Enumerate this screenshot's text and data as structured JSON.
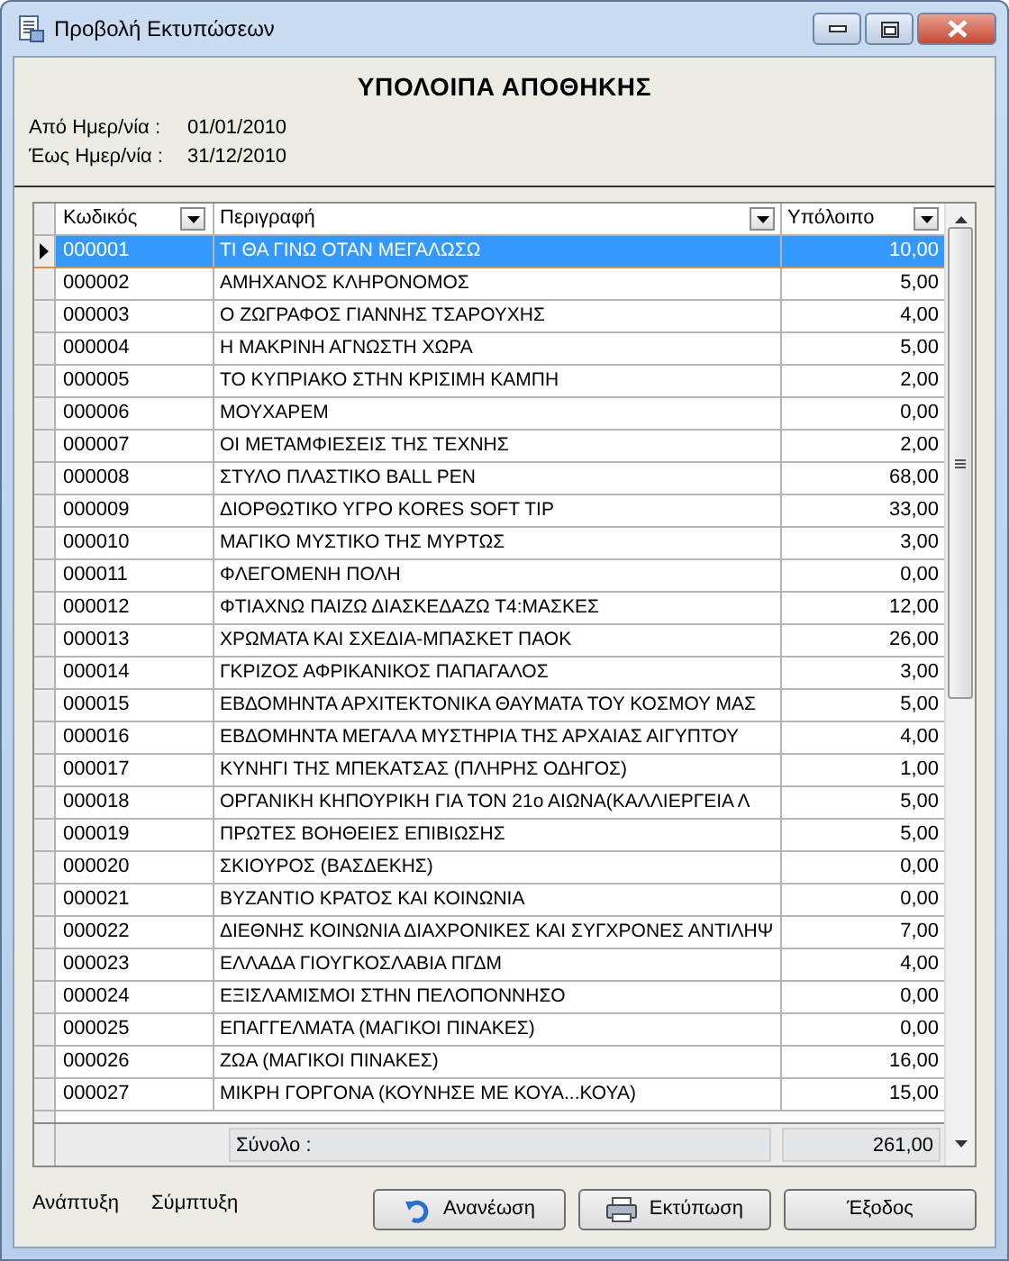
{
  "window": {
    "title": "Προβολή Εκτυπώσεων"
  },
  "report": {
    "title": "ΥΠΟΛΟΙΠΑ ΑΠΟΘΗΚΗΣ",
    "filters": [
      {
        "label": "Από Ημερ/νία :",
        "value": "01/01/2010"
      },
      {
        "label": "Έως Ημερ/νία :",
        "value": "31/12/2010"
      }
    ]
  },
  "table": {
    "columns": [
      "Κωδικός",
      "Περιγραφή",
      "Υπόλοιπο"
    ],
    "rows": [
      {
        "code": "000001",
        "description": "ΤΙ ΘΑ ΓΙΝΩ ΟΤΑΝ ΜΕΓΑΛΩΣΩ",
        "balance": "10,00",
        "selected": true
      },
      {
        "code": "000002",
        "description": "ΑΜΗΧΑΝΟΣ ΚΛΗΡΟΝΟΜΟΣ",
        "balance": "5,00",
        "selected": false
      },
      {
        "code": "000003",
        "description": "Ο ΖΩΓΡΑΦΟΣ ΓΙΑΝΝΗΣ ΤΣΑΡΟΥΧΗΣ",
        "balance": "4,00",
        "selected": false
      },
      {
        "code": "000004",
        "description": "Η ΜΑΚΡΙΝΗ ΑΓΝΩΣΤΗ ΧΩΡΑ",
        "balance": "5,00",
        "selected": false
      },
      {
        "code": "000005",
        "description": "ΤΟ ΚΥΠΡΙΑΚΟ ΣΤΗΝ ΚΡΙΣΙΜΗ ΚΑΜΠΗ",
        "balance": "2,00",
        "selected": false
      },
      {
        "code": "000006",
        "description": "ΜΟΥΧΑΡΕΜ",
        "balance": "0,00",
        "selected": false
      },
      {
        "code": "000007",
        "description": "ΟΙ ΜΕΤΑΜΦΙΕΣΕΙΣ ΤΗΣ ΤΕΧΝΗΣ",
        "balance": "2,00",
        "selected": false
      },
      {
        "code": "000008",
        "description": "ΣΤΥΛΟ ΠΛΑΣΤΙΚΟ BALL PEN",
        "balance": "68,00",
        "selected": false
      },
      {
        "code": "000009",
        "description": "ΔΙΟΡΘΩΤΙΚΟ ΥΓΡΟ KORES SOFT TIP",
        "balance": "33,00",
        "selected": false
      },
      {
        "code": "000010",
        "description": "ΜΑΓΙΚΟ ΜΥΣΤΙΚΟ ΤΗΣ ΜΥΡΤΩΣ",
        "balance": "3,00",
        "selected": false
      },
      {
        "code": "000011",
        "description": "ΦΛΕΓΟΜΕΝΗ ΠΟΛΗ",
        "balance": "0,00",
        "selected": false
      },
      {
        "code": "000012",
        "description": "ΦΤΙΑΧΝΩ ΠΑΙΖΩ ΔΙΑΣΚΕΔΑΖΩ Τ4:ΜΑΣΚΕΣ",
        "balance": "12,00",
        "selected": false
      },
      {
        "code": "000013",
        "description": "ΧΡΩΜΑΤΑ ΚΑΙ ΣΧΕΔΙΑ-ΜΠΑΣΚΕΤ ΠΑΟΚ",
        "balance": "26,00",
        "selected": false
      },
      {
        "code": "000014",
        "description": "ΓΚΡΙΖΟΣ ΑΦΡΙΚΑΝΙΚΟΣ ΠΑΠΑΓΑΛΟΣ",
        "balance": "3,00",
        "selected": false
      },
      {
        "code": "000015",
        "description": "ΕΒΔΟΜΗΝΤΑ ΑΡΧΙΤΕΚΤΟΝΙΚΑ ΘΑΥΜΑΤΑ ΤΟΥ ΚΟΣΜΟΥ ΜΑΣ",
        "balance": "5,00",
        "selected": false
      },
      {
        "code": "000016",
        "description": "ΕΒΔΟΜΗΝΤΑ ΜΕΓΑΛΑ ΜΥΣΤΗΡΙΑ ΤΗΣ ΑΡΧΑΙΑΣ ΑΙΓΥΠΤΟΥ",
        "balance": "4,00",
        "selected": false
      },
      {
        "code": "000017",
        "description": "ΚΥΝΗΓΙ ΤΗΣ ΜΠΕΚΑΤΣΑΣ (ΠΛΗΡΗΣ ΟΔΗΓΟΣ)",
        "balance": "1,00",
        "selected": false
      },
      {
        "code": "000018",
        "description": "ΟΡΓΑΝΙΚΗ ΚΗΠΟΥΡΙΚΗ ΓΙΑ ΤΟΝ 21ο ΑΙΩΝΑ(ΚΑΛΛΙΕΡΓΕΙΑ Λ",
        "balance": "5,00",
        "selected": false
      },
      {
        "code": "000019",
        "description": "ΠΡΩΤΕΣ ΒΟΗΘΕΙΕΣ ΕΠΙΒΙΩΣΗΣ",
        "balance": "5,00",
        "selected": false
      },
      {
        "code": "000020",
        "description": "ΣΚΙΟΥΡΟΣ (ΒΑΣΔΕΚΗΣ)",
        "balance": "0,00",
        "selected": false
      },
      {
        "code": "000021",
        "description": "ΒΥΖΑΝΤΙΟ ΚΡΑΤΟΣ ΚΑΙ ΚΟΙΝΩΝΙΑ",
        "balance": "0,00",
        "selected": false
      },
      {
        "code": "000022",
        "description": "ΔΙΕΘΝΗΣ ΚΟΙΝΩΝΙΑ ΔΙΑΧΡΟΝΙΚΕΣ ΚΑΙ ΣΥΓΧΡΟΝΕΣ ΑΝΤΙΛΗΨ",
        "balance": "7,00",
        "selected": false
      },
      {
        "code": "000023",
        "description": "ΕΛΛΑΔΑ ΓΙΟΥΓΚΟΣΛΑΒΙΑ ΠΓΔΜ",
        "balance": "4,00",
        "selected": false
      },
      {
        "code": "000024",
        "description": "ΕΞΙΣΛΑΜΙΣΜΟΙ ΣΤΗΝ ΠΕΛΟΠΟΝΝΗΣΟ",
        "balance": "0,00",
        "selected": false
      },
      {
        "code": "000025",
        "description": "ΕΠΑΓΓΕΛΜΑΤΑ (ΜΑΓΙΚΟΙ ΠΙΝΑΚΕΣ)",
        "balance": "0,00",
        "selected": false
      },
      {
        "code": "000026",
        "description": "ΖΩΑ (ΜΑΓΙΚΟΙ ΠΙΝΑΚΕΣ)",
        "balance": "16,00",
        "selected": false
      },
      {
        "code": "000027",
        "description": "ΜΙΚΡΗ ΓΟΡΓΟΝΑ (ΚΟΥΝΗΣΕ ΜΕ ΚΟΥΑ...ΚΟΥΑ)",
        "balance": "15,00",
        "selected": false
      }
    ],
    "total": {
      "label": "Σύνολο :",
      "value": "261,00"
    }
  },
  "footer": {
    "links": [
      "Ανάπτυξη",
      "Σύμπτυξη"
    ],
    "buttons": [
      {
        "kind": "refresh",
        "label": "Ανανέωση"
      },
      {
        "kind": "print",
        "label": "Εκτύπωση"
      },
      {
        "kind": "plain",
        "label": "Έξοδος"
      }
    ]
  }
}
